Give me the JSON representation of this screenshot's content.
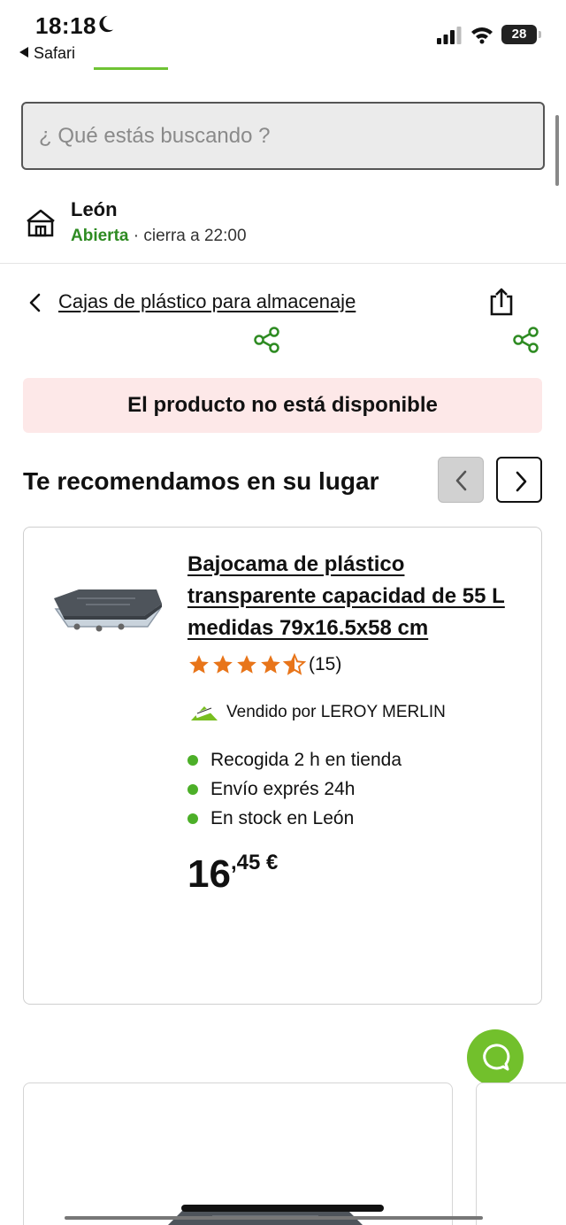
{
  "status_bar": {
    "time": "18:18",
    "back_app": "Safari",
    "battery": "28"
  },
  "search": {
    "placeholder": "¿ Qué estás buscando ?"
  },
  "store": {
    "name": "León",
    "status_open": "Abierta",
    "status_separator": " · ",
    "status_hours": "cierra a 22:00"
  },
  "breadcrumb": {
    "label": "Cajas de plástico para almacenaje"
  },
  "notice": {
    "unavailable": "El producto no está disponible"
  },
  "recommendations": {
    "title": "Te recomendamos en su lugar",
    "product": {
      "title": "Bajocama de plástico transparente capacidad de 55 L medidas 79x16.5x58 cm",
      "rating": 4.5,
      "reviews": "(15)",
      "seller": "Vendido por LEROY MERLIN",
      "features": [
        "Recogida 2 h en tienda",
        "Envío exprés 24h",
        "En stock en León"
      ],
      "price_int": "16",
      "price_dec": ",45 €"
    }
  },
  "colors": {
    "brand_green": "#72c02c",
    "open_green": "#2e8b22",
    "star_orange": "#e8751a",
    "notice_bg": "#fde8e8"
  },
  "icons": {
    "share": "share-icon",
    "export": "export-icon",
    "chat": "chat-icon",
    "store": "store-icon"
  }
}
